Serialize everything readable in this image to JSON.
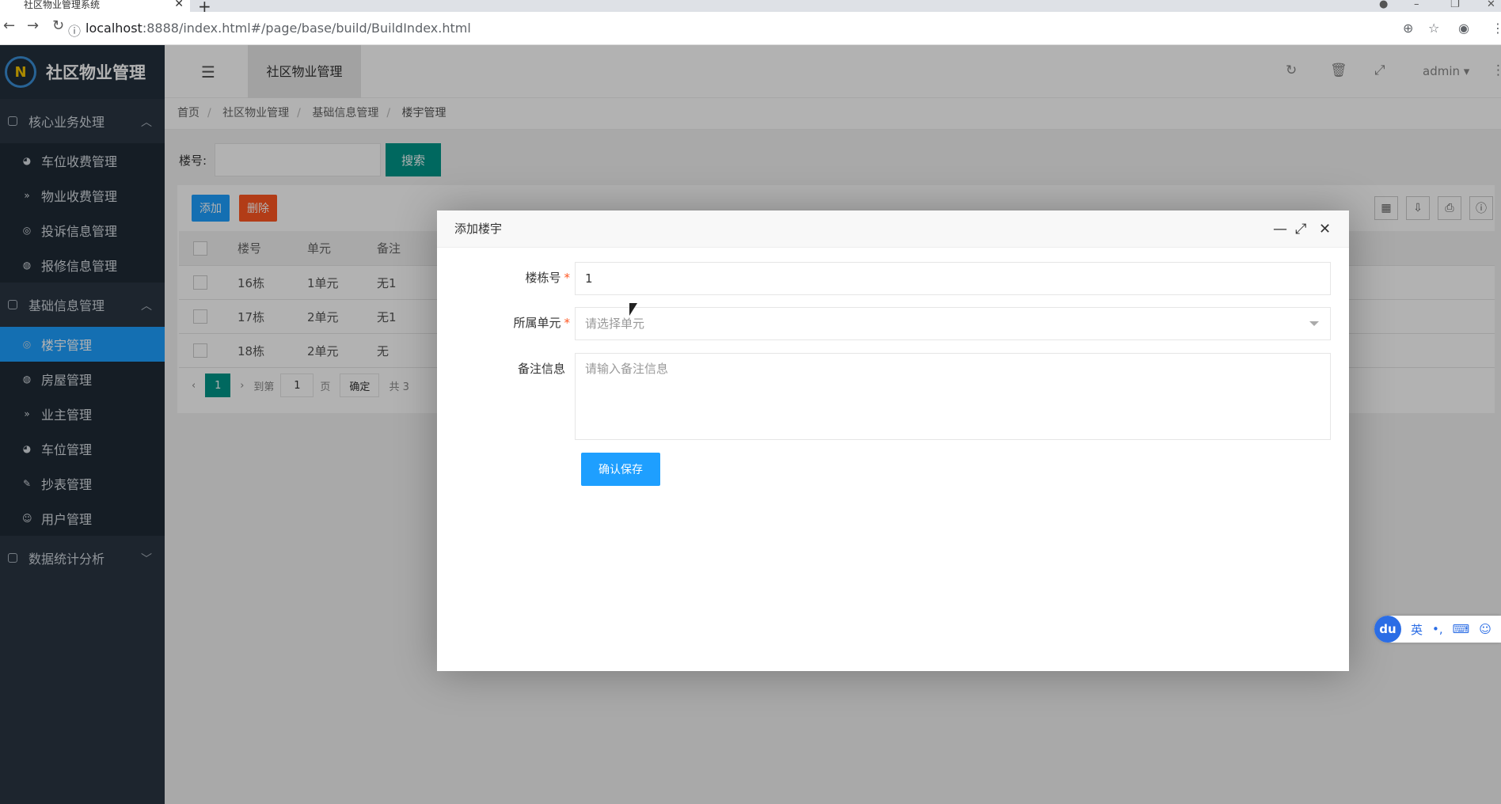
{
  "browser": {
    "tab_title": "社区物业管理系统",
    "url_host": "localhost",
    "url_rest": ":8888/index.html#/page/base/build/BuildIndex.html"
  },
  "sidebar": {
    "brand": "社区物业管理",
    "groups": [
      {
        "label": "核心业务处理",
        "expanded": true,
        "items": [
          {
            "label": "车位收费管理",
            "icon": "dashboard-icon"
          },
          {
            "label": "物业收费管理",
            "icon": "double-chevron-icon"
          },
          {
            "label": "投诉信息管理",
            "icon": "target-icon"
          },
          {
            "label": "报修信息管理",
            "icon": "compass-icon"
          }
        ]
      },
      {
        "label": "基础信息管理",
        "expanded": true,
        "items": [
          {
            "label": "楼宇管理",
            "icon": "target-icon",
            "active": true
          },
          {
            "label": "房屋管理",
            "icon": "compass-icon"
          },
          {
            "label": "业主管理",
            "icon": "double-chevron-icon"
          },
          {
            "label": "车位管理",
            "icon": "dashboard-icon"
          },
          {
            "label": "抄表管理",
            "icon": "edit-icon"
          },
          {
            "label": "用户管理",
            "icon": "user-icon"
          }
        ]
      },
      {
        "label": "数据统计分析",
        "expanded": false,
        "items": []
      }
    ]
  },
  "topbar": {
    "tab": "社区物业管理",
    "user": "admin"
  },
  "breadcrumb": [
    "首页",
    "社区物业管理",
    "基础信息管理",
    "楼宇管理"
  ],
  "search": {
    "label": "楼号:",
    "button": "搜索"
  },
  "toolbar": {
    "add": "添加",
    "delete": "删除"
  },
  "table": {
    "headers": [
      "楼号",
      "单元",
      "备注"
    ],
    "rows": [
      [
        "16栋",
        "1单元",
        "无1"
      ],
      [
        "17栋",
        "2单元",
        "无1"
      ],
      [
        "18栋",
        "2单元",
        "无"
      ]
    ]
  },
  "pager": {
    "page": "1",
    "goto": "到第",
    "page_input": "1",
    "page_unit": "页",
    "confirm": "确定",
    "total": "共 3"
  },
  "modal": {
    "title": "添加楼宇",
    "fields": {
      "building_label": "楼栋号",
      "building_value": "1",
      "unit_label": "所属单元",
      "unit_placeholder": "请选择单元",
      "remark_label": "备注信息",
      "remark_placeholder": "请输入备注信息"
    },
    "save": "确认保存"
  },
  "ime": {
    "logo": "du",
    "lang": "英",
    "punct": "•,"
  },
  "colors": {
    "primary": "#1e9fff",
    "green": "#009688",
    "danger": "#ff5722",
    "sidebar": "#2a3542"
  }
}
